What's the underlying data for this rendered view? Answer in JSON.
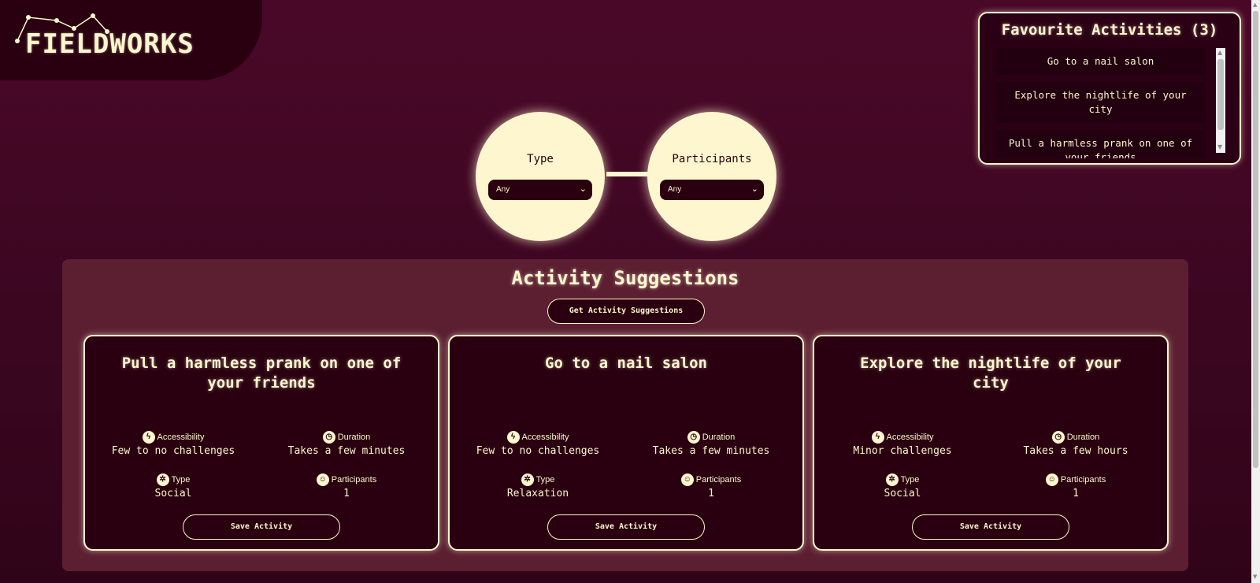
{
  "logo": {
    "text": "FIELDWORKS"
  },
  "favourites": {
    "title": "Favourite Activities (3)",
    "items": [
      "Go to a nail salon",
      "Explore the nightlife of your city",
      "Pull a harmless prank on one of your friends"
    ]
  },
  "filters": {
    "type": {
      "label": "Type",
      "value": "Any"
    },
    "participants": {
      "label": "Participants",
      "value": "Any"
    }
  },
  "suggestions": {
    "title": "Activity Suggestions",
    "get_button": "Get Activity Suggestions",
    "save_label": "Save Activity",
    "labels": {
      "accessibility": "Accessibility",
      "duration": "Duration",
      "type": "Type",
      "participants": "Participants"
    },
    "cards": [
      {
        "title": "Pull a harmless prank on one of your friends",
        "accessibility": "Few to no challenges",
        "duration": "Takes a few minutes",
        "type": "Social",
        "participants": "1"
      },
      {
        "title": "Go to a nail salon",
        "accessibility": "Few to no challenges",
        "duration": "Takes a few minutes",
        "type": "Relaxation",
        "participants": "1"
      },
      {
        "title": "Explore the nightlife of your city",
        "accessibility": "Minor challenges",
        "duration": "Takes a few hours",
        "type": "Social",
        "participants": "1"
      }
    ]
  },
  "icons": {
    "accessibility": "lightning-icon",
    "duration": "clock-icon",
    "type": "type-icon",
    "participants": "people-icon"
  },
  "colors": {
    "background": "#4a0828",
    "cream": "#fdf6cf",
    "card": "#2a0010",
    "panel": "#5c1f32"
  }
}
